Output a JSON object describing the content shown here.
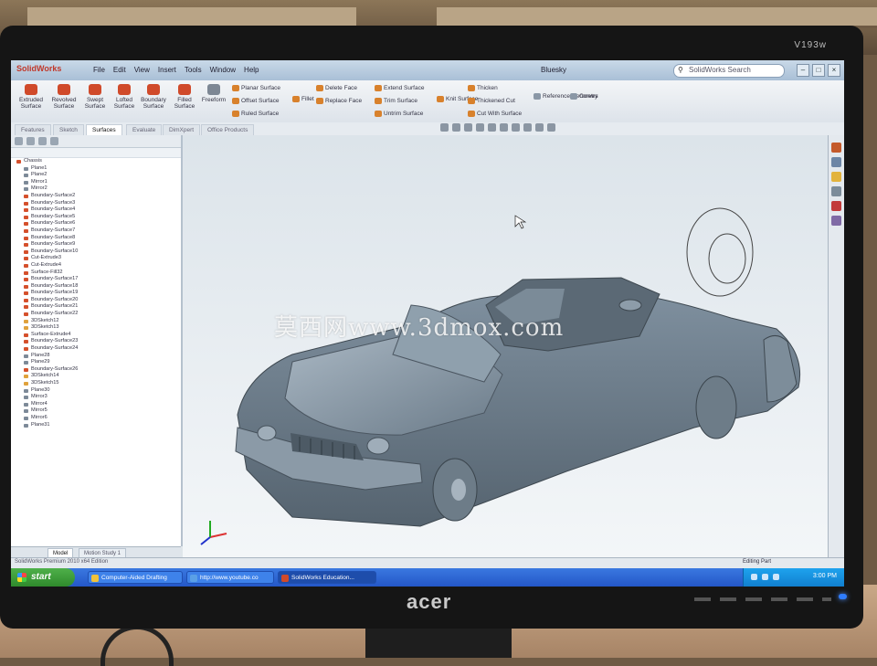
{
  "screen": {
    "app_logo": "SolidWorks",
    "menu": [
      "File",
      "Edit",
      "View",
      "Insert",
      "Tools",
      "Window",
      "Help"
    ],
    "doc_name": "Bluesky",
    "search_placeholder": "SolidWorks Search"
  },
  "monitor": {
    "brand": "acer",
    "model": "V193w"
  },
  "ribbon": {
    "big_buttons": [
      "Extruded Surface",
      "Revolved Surface",
      "Swept Surface",
      "Lofted Surface",
      "Boundary Surface",
      "Filled Surface",
      "Freeform"
    ],
    "small_buttons": [
      "Planar Surface",
      "Offset Surface",
      "Ruled Surface",
      "Fillet",
      "Delete Face",
      "Replace Face",
      "Extend Surface",
      "Trim Surface",
      "Untrim Surface",
      "Knit Surface",
      "Thicken",
      "Thickened Cut",
      "Cut With Surface",
      "Reference Geometry",
      "Curves"
    ]
  },
  "command_tabs": [
    "Features",
    "Sketch",
    "Surfaces",
    "Evaluate",
    "DimXpert",
    "Office Products"
  ],
  "active_tab": "Surfaces",
  "tree_items": [
    "Chassis",
    "Plane1",
    "Plane2",
    "Mirror1",
    "Mirror2",
    "Boundary-Surface2",
    "Boundary-Surface3",
    "Boundary-Surface4",
    "Boundary-Surface5",
    "Boundary-Surface6",
    "Boundary-Surface7",
    "Boundary-Surface8",
    "Boundary-Surface9",
    "Boundary-Surface10",
    "Cut-Extrude3",
    "Cut-Extrude4",
    "Surface-Fill32",
    "Boundary-Surface17",
    "Boundary-Surface18",
    "Boundary-Surface19",
    "Boundary-Surface20",
    "Boundary-Surface21",
    "Boundary-Surface22",
    "3DSketch12",
    "3DSketch13",
    "Surface-Extrude4",
    "Boundary-Surface23",
    "Boundary-Surface24",
    "Plane28",
    "Plane29",
    "Boundary-Surface26",
    "3DSketch14",
    "3DSketch15",
    "Plane30",
    "Mirror3",
    "Mirror4",
    "Mirror5",
    "Mirror6",
    "Plane31"
  ],
  "bottom_tabs": [
    "Model",
    "Motion Study 1"
  ],
  "statusbar": {
    "left": "SolidWorks Premium 2010 x64 Edition",
    "right": "Editing Part"
  },
  "watermark": "莫西网www.3dmox.com",
  "taskbar": {
    "start": "start",
    "tasks": [
      "Computer-Aided Drafting",
      "http://www.youtube.co",
      "SolidWorks Education..."
    ],
    "clock": "3:00 PM"
  },
  "colors": {
    "surface_tab_accent": "#d04a2a",
    "taskbar": "#2457c8",
    "start_button": "#3b9a36",
    "model_body": "#6c7d8c"
  }
}
